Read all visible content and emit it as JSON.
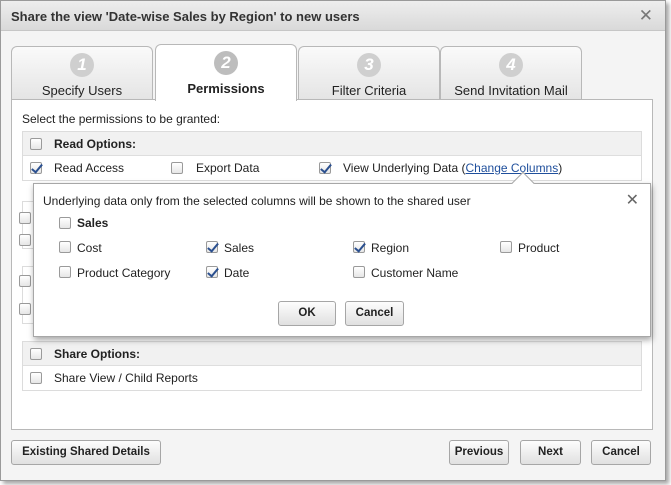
{
  "dialog": {
    "title": "Share the view 'Date-wise Sales by Region' to new users",
    "close_glyph": "✕"
  },
  "tabs": [
    {
      "number": "1",
      "label": "Specify Users",
      "active": false
    },
    {
      "number": "2",
      "label": "Permissions",
      "active": true
    },
    {
      "number": "3",
      "label": "Filter Criteria",
      "active": false
    },
    {
      "number": "4",
      "label": "Send Invitation Mail",
      "active": false
    }
  ],
  "permissions": {
    "instruction": "Select the permissions to be granted:",
    "read_options": {
      "header": "Read Options:",
      "items": [
        {
          "label": "Read Access",
          "checked": true
        },
        {
          "label": "Export Data",
          "checked": false
        },
        {
          "label": "View Underlying Data (",
          "checked": true,
          "link": "Change Columns",
          "suffix": ")"
        }
      ]
    },
    "share_options": {
      "header": "Share Options:",
      "items": [
        {
          "label": "Share View / Child Reports",
          "checked": false
        }
      ]
    }
  },
  "columns_popup": {
    "message": "Underlying data only from the selected columns will be shown to the shared user",
    "close_glyph": "✕",
    "group": {
      "label": "Sales",
      "checked": false
    },
    "columns": [
      {
        "label": "Cost",
        "checked": false
      },
      {
        "label": "Sales",
        "checked": true
      },
      {
        "label": "Region",
        "checked": true
      },
      {
        "label": "Product",
        "checked": false
      },
      {
        "label": "Product Category",
        "checked": false
      },
      {
        "label": "Date",
        "checked": true
      },
      {
        "label": "Customer Name",
        "checked": false
      }
    ],
    "ok_label": "OK",
    "cancel_label": "Cancel"
  },
  "footer": {
    "existing_label": "Existing Shared Details",
    "previous_label": "Previous",
    "next_label": "Next",
    "cancel_label": "Cancel"
  }
}
